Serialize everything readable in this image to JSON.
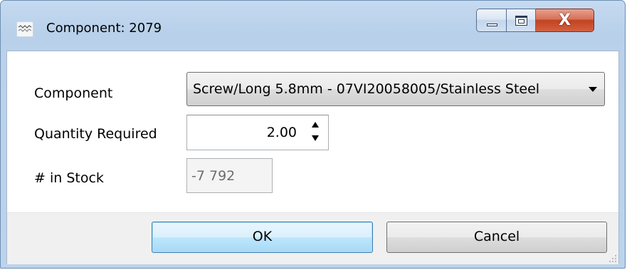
{
  "window": {
    "title": "Component: 2079",
    "icons": {
      "app": "app-logo-icon",
      "minimize": "minimize-icon",
      "maximize": "maximize-icon",
      "close": "close-icon"
    },
    "close_glyph": "X"
  },
  "form": {
    "component_label": "Component",
    "component_value": "Screw/Long 5.8mm - 07VI20058005/Stainless Steel",
    "quantity_label": "Quantity Required",
    "quantity_value": "2.00",
    "stock_label": "# in Stock",
    "stock_value": "-7 792"
  },
  "buttons": {
    "ok_label": "OK",
    "cancel_label": "Cancel"
  },
  "colors": {
    "accent": "#3c7fb1",
    "close_red": "#c2431f",
    "titlebar": "#b8d0ea"
  }
}
